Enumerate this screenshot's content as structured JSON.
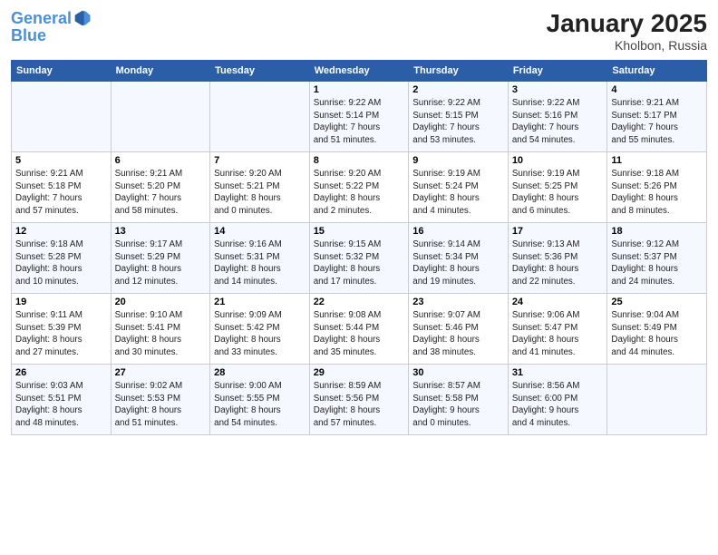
{
  "header": {
    "logo_line1": "General",
    "logo_line2": "Blue",
    "month_title": "January 2025",
    "location": "Kholbon, Russia"
  },
  "days_of_week": [
    "Sunday",
    "Monday",
    "Tuesday",
    "Wednesday",
    "Thursday",
    "Friday",
    "Saturday"
  ],
  "weeks": [
    [
      {
        "day": "",
        "info": ""
      },
      {
        "day": "",
        "info": ""
      },
      {
        "day": "",
        "info": ""
      },
      {
        "day": "1",
        "info": "Sunrise: 9:22 AM\nSunset: 5:14 PM\nDaylight: 7 hours\nand 51 minutes."
      },
      {
        "day": "2",
        "info": "Sunrise: 9:22 AM\nSunset: 5:15 PM\nDaylight: 7 hours\nand 53 minutes."
      },
      {
        "day": "3",
        "info": "Sunrise: 9:22 AM\nSunset: 5:16 PM\nDaylight: 7 hours\nand 54 minutes."
      },
      {
        "day": "4",
        "info": "Sunrise: 9:21 AM\nSunset: 5:17 PM\nDaylight: 7 hours\nand 55 minutes."
      }
    ],
    [
      {
        "day": "5",
        "info": "Sunrise: 9:21 AM\nSunset: 5:18 PM\nDaylight: 7 hours\nand 57 minutes."
      },
      {
        "day": "6",
        "info": "Sunrise: 9:21 AM\nSunset: 5:20 PM\nDaylight: 7 hours\nand 58 minutes."
      },
      {
        "day": "7",
        "info": "Sunrise: 9:20 AM\nSunset: 5:21 PM\nDaylight: 8 hours\nand 0 minutes."
      },
      {
        "day": "8",
        "info": "Sunrise: 9:20 AM\nSunset: 5:22 PM\nDaylight: 8 hours\nand 2 minutes."
      },
      {
        "day": "9",
        "info": "Sunrise: 9:19 AM\nSunset: 5:24 PM\nDaylight: 8 hours\nand 4 minutes."
      },
      {
        "day": "10",
        "info": "Sunrise: 9:19 AM\nSunset: 5:25 PM\nDaylight: 8 hours\nand 6 minutes."
      },
      {
        "day": "11",
        "info": "Sunrise: 9:18 AM\nSunset: 5:26 PM\nDaylight: 8 hours\nand 8 minutes."
      }
    ],
    [
      {
        "day": "12",
        "info": "Sunrise: 9:18 AM\nSunset: 5:28 PM\nDaylight: 8 hours\nand 10 minutes."
      },
      {
        "day": "13",
        "info": "Sunrise: 9:17 AM\nSunset: 5:29 PM\nDaylight: 8 hours\nand 12 minutes."
      },
      {
        "day": "14",
        "info": "Sunrise: 9:16 AM\nSunset: 5:31 PM\nDaylight: 8 hours\nand 14 minutes."
      },
      {
        "day": "15",
        "info": "Sunrise: 9:15 AM\nSunset: 5:32 PM\nDaylight: 8 hours\nand 17 minutes."
      },
      {
        "day": "16",
        "info": "Sunrise: 9:14 AM\nSunset: 5:34 PM\nDaylight: 8 hours\nand 19 minutes."
      },
      {
        "day": "17",
        "info": "Sunrise: 9:13 AM\nSunset: 5:36 PM\nDaylight: 8 hours\nand 22 minutes."
      },
      {
        "day": "18",
        "info": "Sunrise: 9:12 AM\nSunset: 5:37 PM\nDaylight: 8 hours\nand 24 minutes."
      }
    ],
    [
      {
        "day": "19",
        "info": "Sunrise: 9:11 AM\nSunset: 5:39 PM\nDaylight: 8 hours\nand 27 minutes."
      },
      {
        "day": "20",
        "info": "Sunrise: 9:10 AM\nSunset: 5:41 PM\nDaylight: 8 hours\nand 30 minutes."
      },
      {
        "day": "21",
        "info": "Sunrise: 9:09 AM\nSunset: 5:42 PM\nDaylight: 8 hours\nand 33 minutes."
      },
      {
        "day": "22",
        "info": "Sunrise: 9:08 AM\nSunset: 5:44 PM\nDaylight: 8 hours\nand 35 minutes."
      },
      {
        "day": "23",
        "info": "Sunrise: 9:07 AM\nSunset: 5:46 PM\nDaylight: 8 hours\nand 38 minutes."
      },
      {
        "day": "24",
        "info": "Sunrise: 9:06 AM\nSunset: 5:47 PM\nDaylight: 8 hours\nand 41 minutes."
      },
      {
        "day": "25",
        "info": "Sunrise: 9:04 AM\nSunset: 5:49 PM\nDaylight: 8 hours\nand 44 minutes."
      }
    ],
    [
      {
        "day": "26",
        "info": "Sunrise: 9:03 AM\nSunset: 5:51 PM\nDaylight: 8 hours\nand 48 minutes."
      },
      {
        "day": "27",
        "info": "Sunrise: 9:02 AM\nSunset: 5:53 PM\nDaylight: 8 hours\nand 51 minutes."
      },
      {
        "day": "28",
        "info": "Sunrise: 9:00 AM\nSunset: 5:55 PM\nDaylight: 8 hours\nand 54 minutes."
      },
      {
        "day": "29",
        "info": "Sunrise: 8:59 AM\nSunset: 5:56 PM\nDaylight: 8 hours\nand 57 minutes."
      },
      {
        "day": "30",
        "info": "Sunrise: 8:57 AM\nSunset: 5:58 PM\nDaylight: 9 hours\nand 0 minutes."
      },
      {
        "day": "31",
        "info": "Sunrise: 8:56 AM\nSunset: 6:00 PM\nDaylight: 9 hours\nand 4 minutes."
      },
      {
        "day": "",
        "info": ""
      }
    ]
  ]
}
